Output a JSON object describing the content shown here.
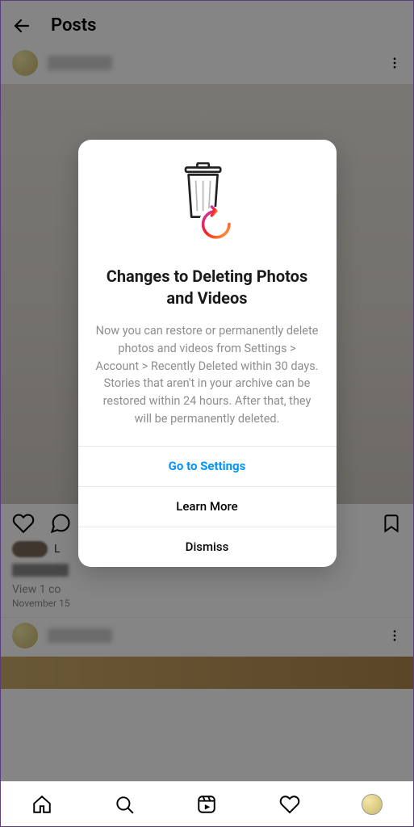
{
  "header": {
    "title": "Posts"
  },
  "post": {
    "comments_label": "View 1 co",
    "date": "November 15"
  },
  "dialog": {
    "title": "Changes to Deleting Photos and Videos",
    "description": "Now you can restore or permanently delete photos and videos from Settings > Account > Recently Deleted within 30 days. Stories that aren't in your archive can be restored within 24 hours. After that, they will be permanently deleted.",
    "primary_button": "Go to Settings",
    "learn_more": "Learn More",
    "dismiss": "Dismiss"
  }
}
